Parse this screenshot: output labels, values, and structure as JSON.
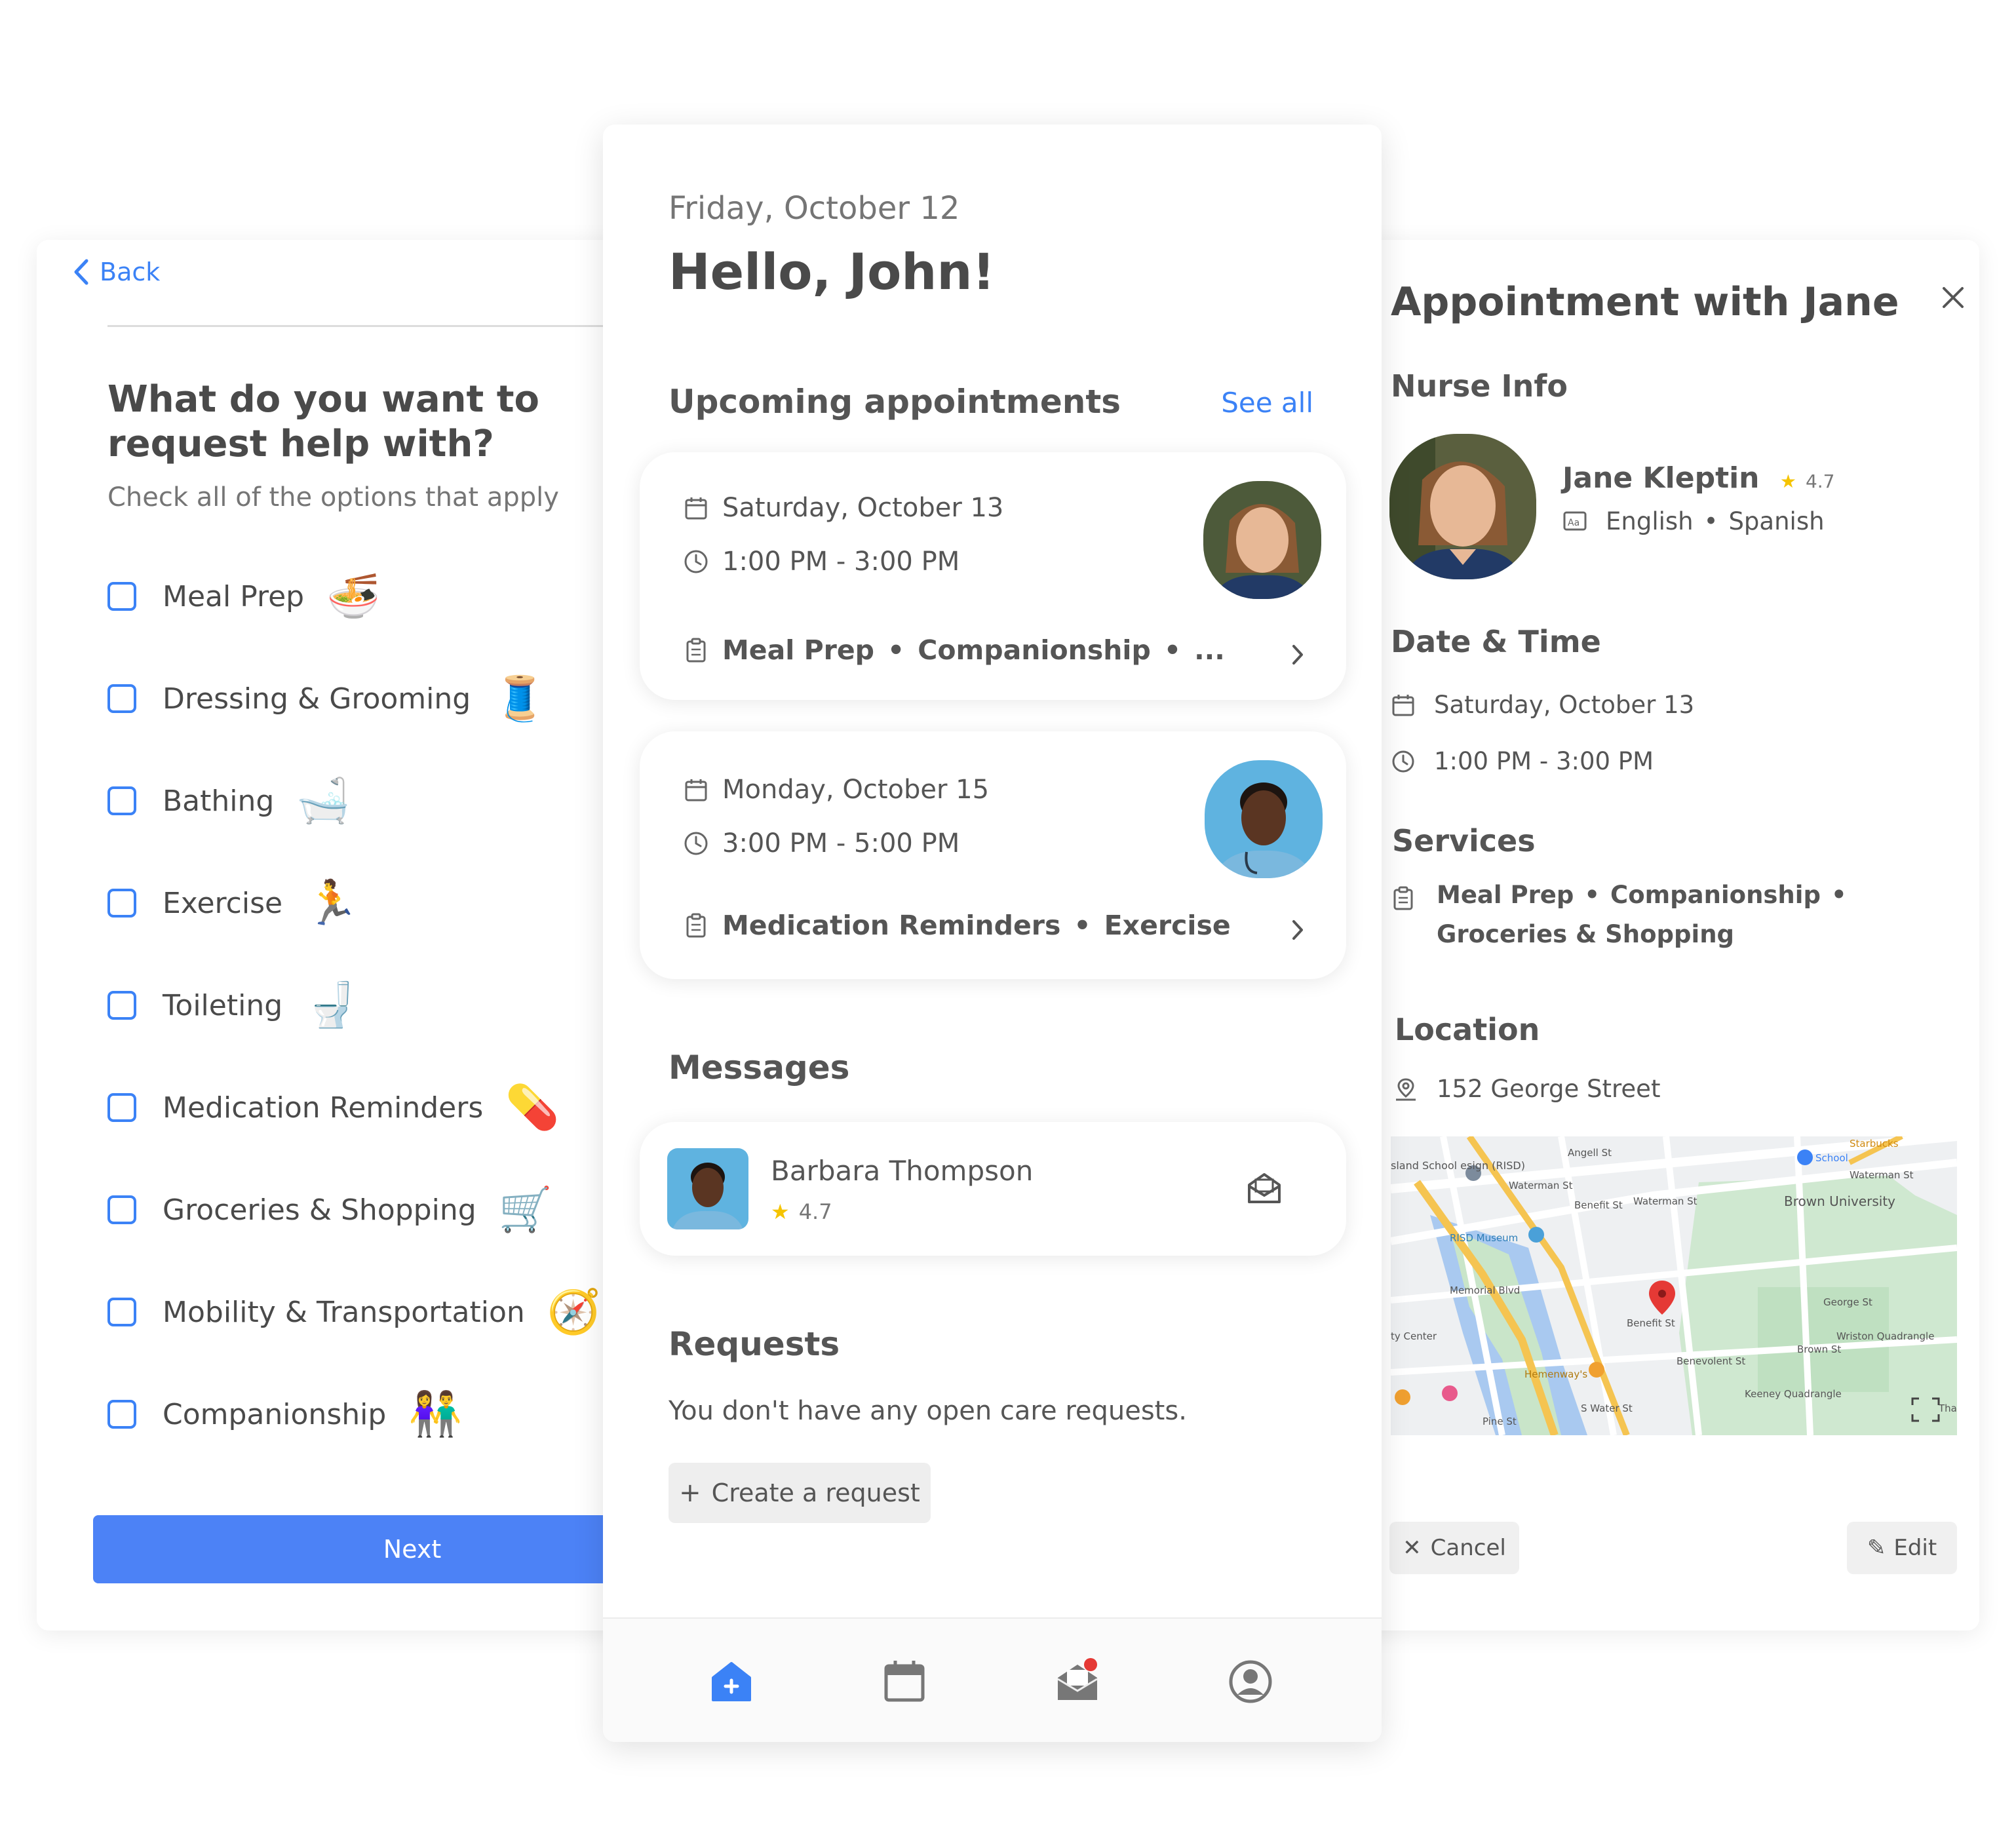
{
  "request_form": {
    "back_label": "Back",
    "title": "What do you want to request help with?",
    "subtitle": "Check all of the options that apply",
    "options": [
      {
        "label": "Meal Prep",
        "emoji": "🍜"
      },
      {
        "label": "Dressing & Grooming",
        "emoji": "🧵"
      },
      {
        "label": "Bathing",
        "emoji": "🛁"
      },
      {
        "label": "Exercise",
        "emoji": "🏃"
      },
      {
        "label": "Toileting",
        "emoji": "🚽"
      },
      {
        "label": "Medication Reminders",
        "emoji": "💊"
      },
      {
        "label": "Groceries & Shopping",
        "emoji": "🛒"
      },
      {
        "label": "Mobility & Transportation",
        "emoji": "🧭"
      },
      {
        "label": "Companionship",
        "emoji": "👫"
      }
    ],
    "next_label": "Next"
  },
  "home": {
    "date": "Friday, October 12",
    "greeting": "Hello, John!",
    "upcoming_title": "Upcoming appointments",
    "see_all": "See all",
    "appointments": [
      {
        "date": "Saturday, October 13",
        "time": "1:00 PM - 3:00 PM",
        "services": [
          "Meal Prep",
          "Companionship",
          "..."
        ]
      },
      {
        "date": "Monday, October 15",
        "time": "3:00 PM - 5:00 PM",
        "services": [
          "Medication Reminders",
          "Exercise"
        ]
      }
    ],
    "messages_title": "Messages",
    "message": {
      "name": "Barbara Thompson",
      "rating": "4.7"
    },
    "requests_title": "Requests",
    "requests_empty": "You don't have any open care requests.",
    "create_request": "Create a request",
    "tabs": [
      "home-icon",
      "calendar-icon",
      "messages-icon",
      "profile-icon"
    ],
    "accent": "#3b82f6"
  },
  "appointment_detail": {
    "title": "Appointment with Jane",
    "nurse_info_title": "Nurse Info",
    "nurse_name": "Jane Kleptin",
    "nurse_rating": "4.7",
    "languages": [
      "English",
      "Spanish"
    ],
    "datetime_title": "Date & Time",
    "date": "Saturday, October 13",
    "time": "1:00 PM - 3:00 PM",
    "services_title": "Services",
    "services": [
      "Meal Prep",
      "Companionship",
      "Groceries & Shopping"
    ],
    "location_title": "Location",
    "address": "152  George Street",
    "map_labels": {
      "starbucks": "Starbucks",
      "school": "School",
      "angell": "Angell St",
      "waterman1": "Waterman St",
      "waterman2": "Waterman St",
      "waterman3": "Waterman St",
      "brown": "Brown University",
      "risd_school": "sland School esign (RISD)",
      "risd_museum": "RISD Museum",
      "benefit1": "Benefit St",
      "benefit2": "Benefit St",
      "memorial": "Memorial Blvd",
      "george": "George St",
      "wriston": "Wriston Quadrangle",
      "city_center": "ty Center",
      "benevolent": "Benevolent St",
      "brown_st": "Brown St",
      "hemenway": "Hemenway's",
      "keeney": "Keeney Quadrangle",
      "thayer": "Thayer St",
      "water": "S Water St",
      "pine": "Pine St"
    },
    "cancel_label": "Cancel",
    "edit_label": "Edit"
  }
}
